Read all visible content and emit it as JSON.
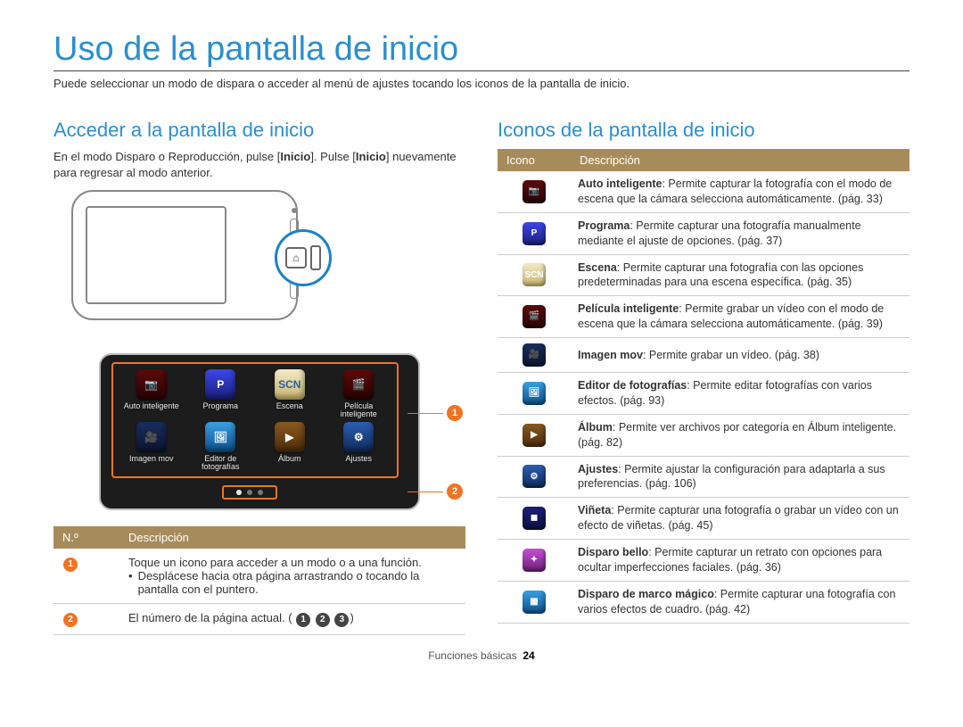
{
  "title": "Uso de la pantalla de inicio",
  "subtitle": "Puede seleccionar un modo de dispara o acceder al menú de ajustes tocando los iconos de la pantalla de inicio.",
  "left": {
    "heading": "Acceder a la pantalla de inicio",
    "para_prefix": "En el modo Disparo o Reproducción, pulse [",
    "inicio1": "Inicio",
    "para_mid": "]. Pulse [",
    "inicio2": "Inicio",
    "para_suffix": "] nuevamente para regresar al modo anterior.",
    "grid_labels": [
      "Auto inteligente",
      "Programa",
      "Escena",
      "Película inteligente",
      "Imagen mov",
      "Editor de fotografías",
      "Álbum",
      "Ajustes"
    ],
    "grid_glyph": [
      "📷",
      "P",
      "SCN",
      "🎬",
      "🎥",
      "🖼",
      "▶",
      "⚙"
    ],
    "table": {
      "h1": "N.º",
      "h2": "Descripción",
      "r1a": "Toque un icono para acceder a un modo o a una función.",
      "r1b": "Desplácese hacia otra página arrastrando o tocando la pantalla con el puntero.",
      "r2": "El número de la página actual. ("
    }
  },
  "right": {
    "heading": "Iconos de la pantalla de inicio",
    "h1": "Icono",
    "h2": "Descripción",
    "rows": [
      {
        "cls": "ic-auto",
        "glyph": "📷",
        "b": "Auto inteligente",
        "t": ": Permite capturar la fotografía con el modo de escena que la cámara selecciona automáticamente. (pág. 33)"
      },
      {
        "cls": "ic-prog",
        "glyph": "P",
        "b": "Programa",
        "t": ": Permite capturar una fotografía manualmente mediante el ajuste de opciones. (pág. 37)"
      },
      {
        "cls": "ic-scn",
        "glyph": "SCN",
        "b": "Escena",
        "t": ": Permite capturar una fotografía con las opciones predeterminadas para una escena específica. (pág. 35)"
      },
      {
        "cls": "ic-movie",
        "glyph": "🎬",
        "b": "Película inteligente",
        "t": ": Permite grabar un vídeo con el modo de escena que la cámara selecciona automáticamente. (pág. 39)"
      },
      {
        "cls": "ic-mov",
        "glyph": "🎥",
        "b": "Imagen mov",
        "t": ": Permite grabar un vídeo. (pág. 38)"
      },
      {
        "cls": "ic-edit",
        "glyph": "🖼",
        "b": "Editor de fotografías",
        "t": ": Permite editar fotografías con varios efectos. (pág. 93)"
      },
      {
        "cls": "ic-album",
        "glyph": "▶",
        "b": "Álbum",
        "t": ": Permite ver archivos por categoría en Álbum inteligente. (pág. 82)"
      },
      {
        "cls": "ic-set",
        "glyph": "⚙",
        "b": "Ajustes",
        "t": ": Permite ajustar la configuración para adaptarla a sus preferencias. (pág. 106)"
      },
      {
        "cls": "ic-vig",
        "glyph": "◼",
        "b": "Viñeta",
        "t": ": Permite capturar una fotografía o grabar un vídeo con un efecto de viñetas. (pág. 45)"
      },
      {
        "cls": "ic-beau",
        "glyph": "✦",
        "b": "Disparo bello",
        "t": ": Permite capturar un retrato con opciones para ocultar imperfecciones faciales. (pág. 36)"
      },
      {
        "cls": "ic-magic",
        "glyph": "▦",
        "b": "Disparo de marco mágico",
        "t": ": Permite capturar una fotografía con varios efectos de cuadro. (pág. 42)"
      }
    ]
  },
  "footer": {
    "section": "Funciones básicas",
    "page": "24"
  }
}
